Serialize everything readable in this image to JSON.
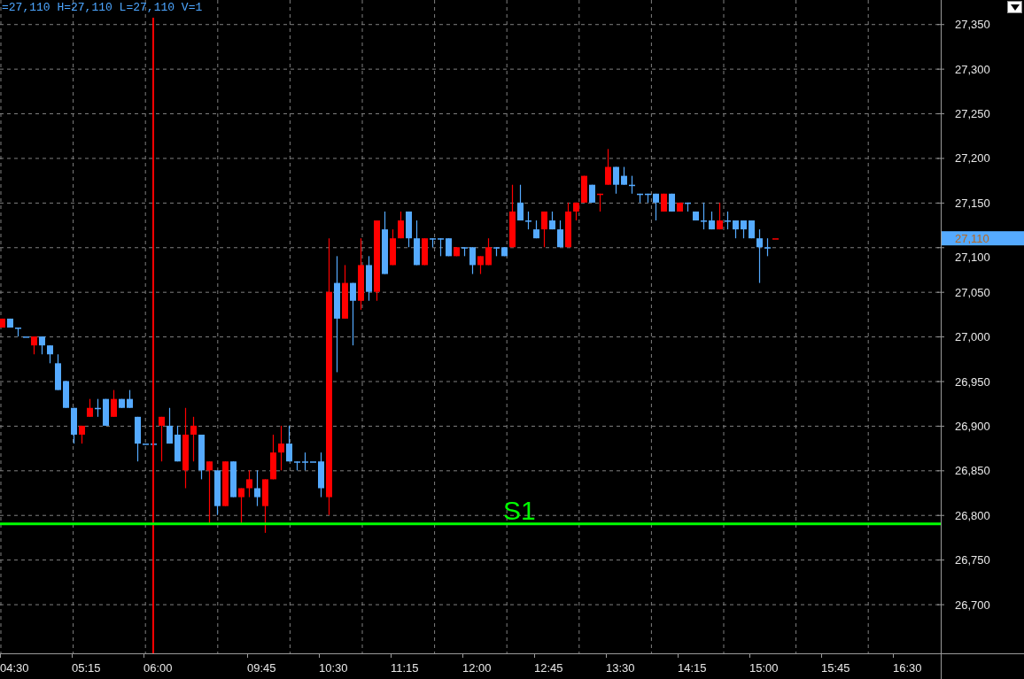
{
  "readout": "=27,110 H=27,110 L=27,110 V=1",
  "price_axis": {
    "labels": [
      "27,350",
      "27,300",
      "27,250",
      "27,200",
      "27,150",
      "27,100",
      "27,050",
      "27,000",
      "26,950",
      "26,900",
      "26,850",
      "26,800",
      "26,750",
      "26,700"
    ],
    "current_price": "27,110"
  },
  "time_axis": {
    "labels": [
      "04:30",
      "05:15",
      "06:00",
      "09:45",
      "10:30",
      "11:15",
      "12:00",
      "12:45",
      "13:30",
      "14:15",
      "15:00",
      "15:45",
      "16:30"
    ]
  },
  "support_line": {
    "label": "S1"
  }
}
